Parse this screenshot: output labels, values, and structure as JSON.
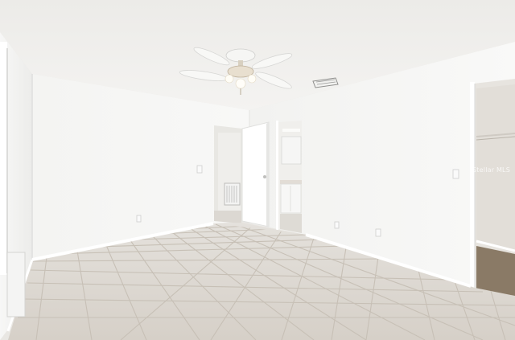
{
  "photo": {
    "subject": "empty-bedroom-interior",
    "watermark_text": "Stellar MLS",
    "colors": {
      "ceiling": "#f2f1ee",
      "wall": "#f6f6f4",
      "wall_shadow": "#e6e6e3",
      "floor_tile": "#d9d4cd",
      "grout": "#c9c2b8",
      "baseboard": "#ffffff",
      "closet_floor": "#8a7a66",
      "door": "#ffffff"
    }
  }
}
